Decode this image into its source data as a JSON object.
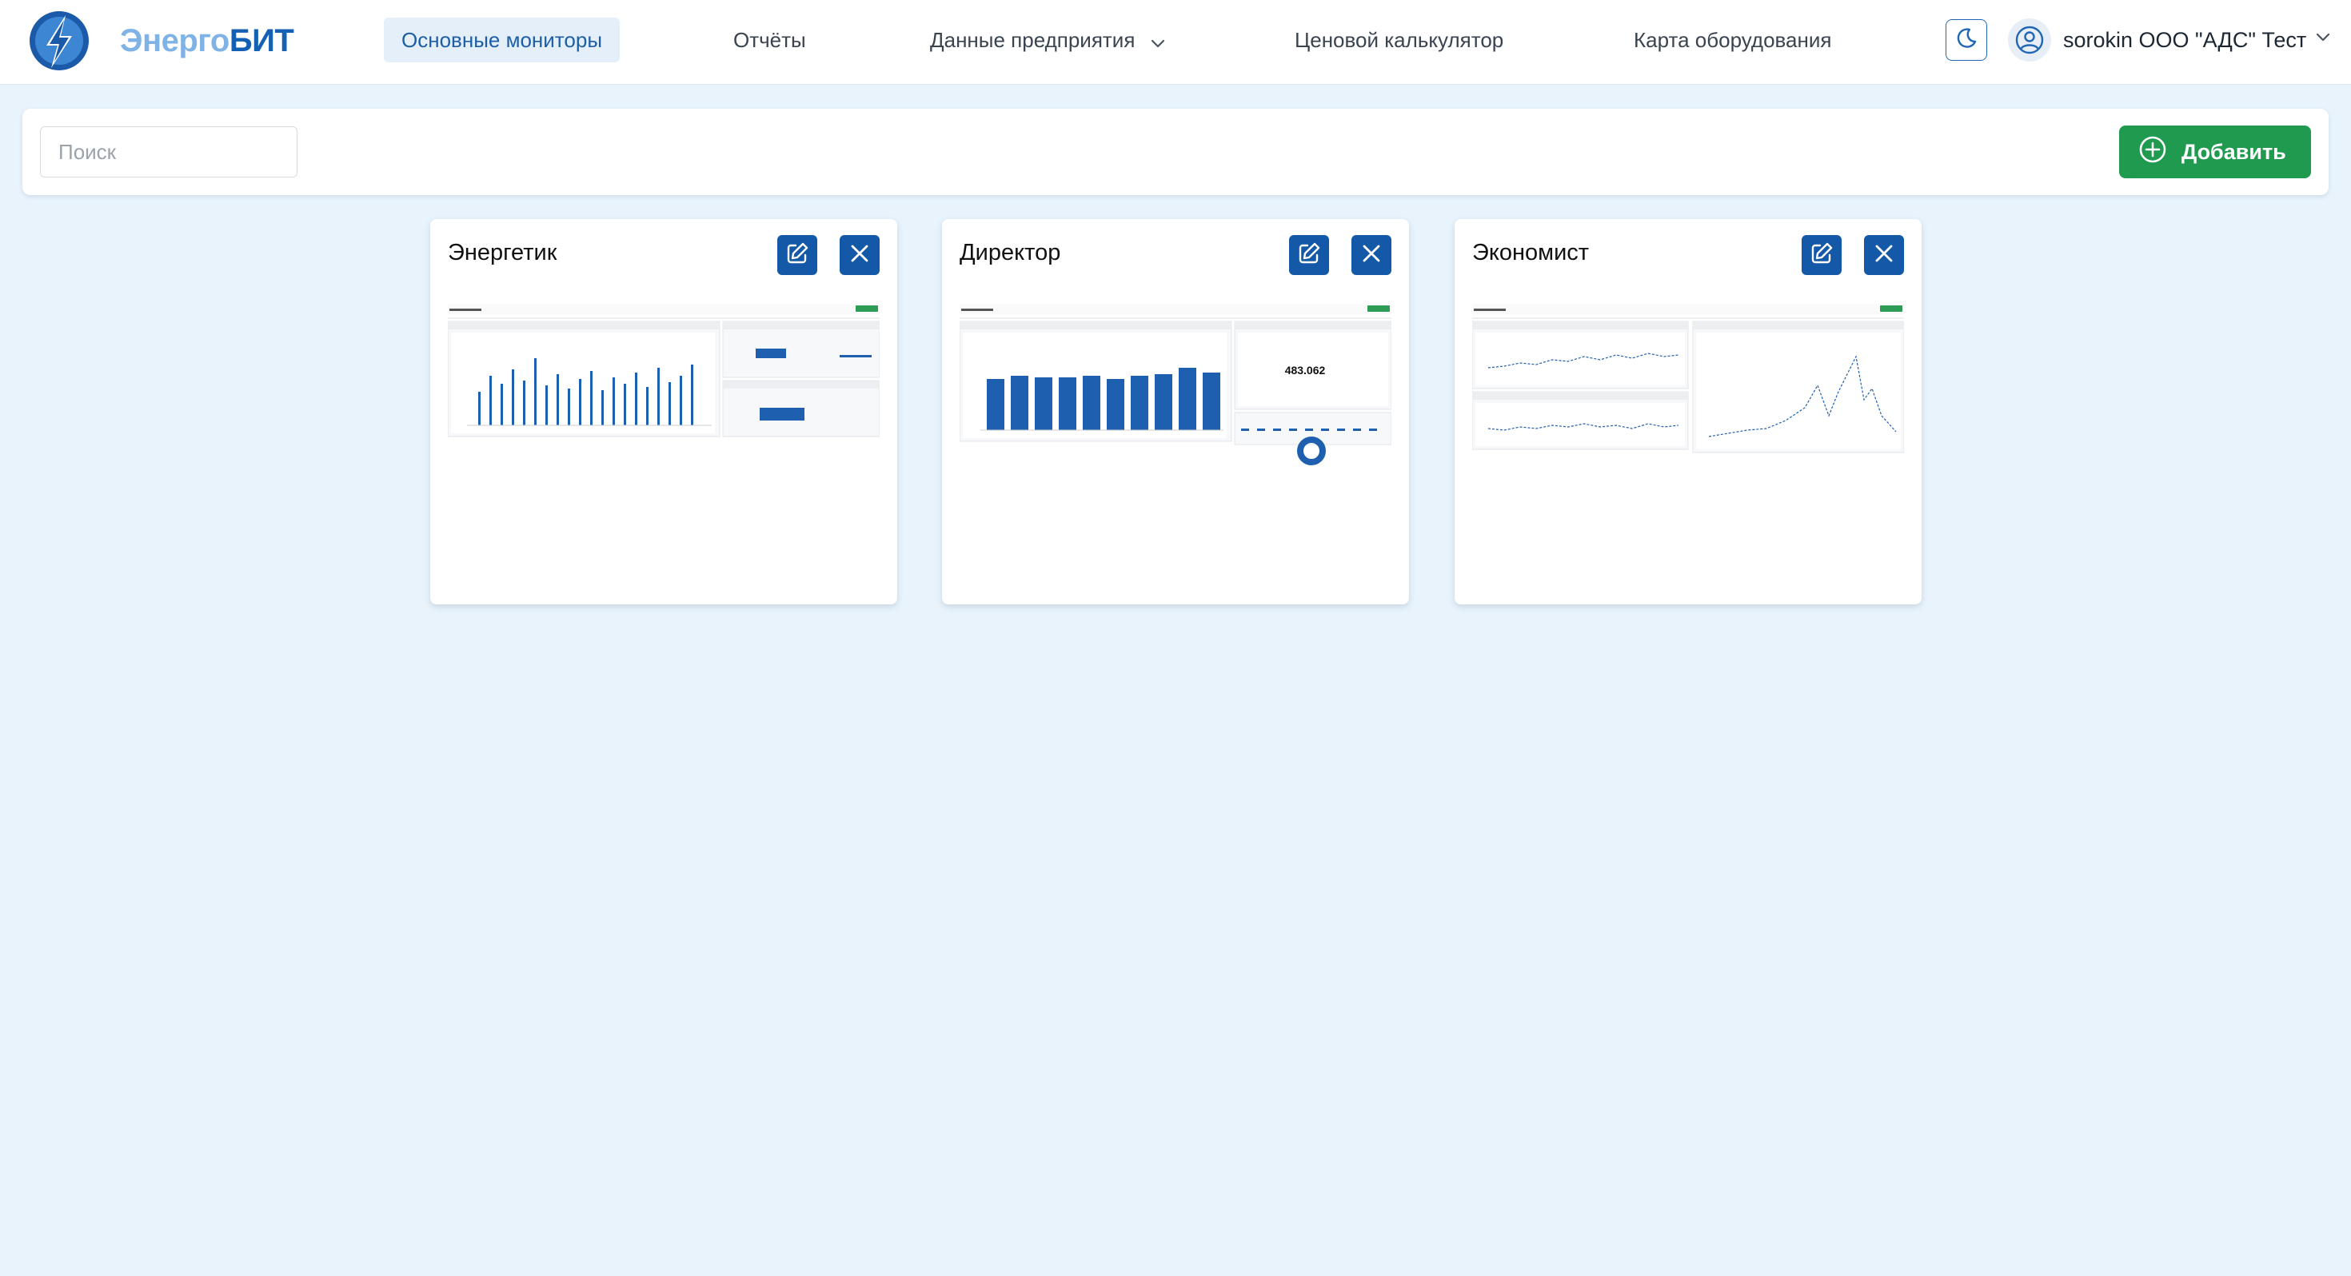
{
  "brand": {
    "part1": "Энерго",
    "part2": "БИТ"
  },
  "nav": {
    "items": [
      {
        "label": "Основные мониторы",
        "active": true
      },
      {
        "label": "Отчёты"
      },
      {
        "label": "Данные предприятия",
        "has_dropdown": true
      },
      {
        "label": "Ценовой калькулятор"
      },
      {
        "label": "Карта оборудования"
      }
    ]
  },
  "user": {
    "name": "sorokin ООО \"АДС\" Тест"
  },
  "toolbar": {
    "search_placeholder": "Поиск",
    "add_label": "Добавить"
  },
  "monitors": [
    {
      "title": "Энергетик"
    },
    {
      "title": "Директор",
      "preview_value": "483.062"
    },
    {
      "title": "Экономист"
    }
  ],
  "colors": {
    "accent": "#1458a8",
    "success": "#1f9a4f",
    "background": "#e8f3fc",
    "brand_light": "#7fb3e6",
    "brand_dark": "#1460b3"
  },
  "icons": [
    "logo-lightning-icon",
    "moon-icon",
    "user-circle-icon",
    "chevron-down-icon",
    "plus-circle-icon",
    "edit-icon",
    "close-icon"
  ]
}
